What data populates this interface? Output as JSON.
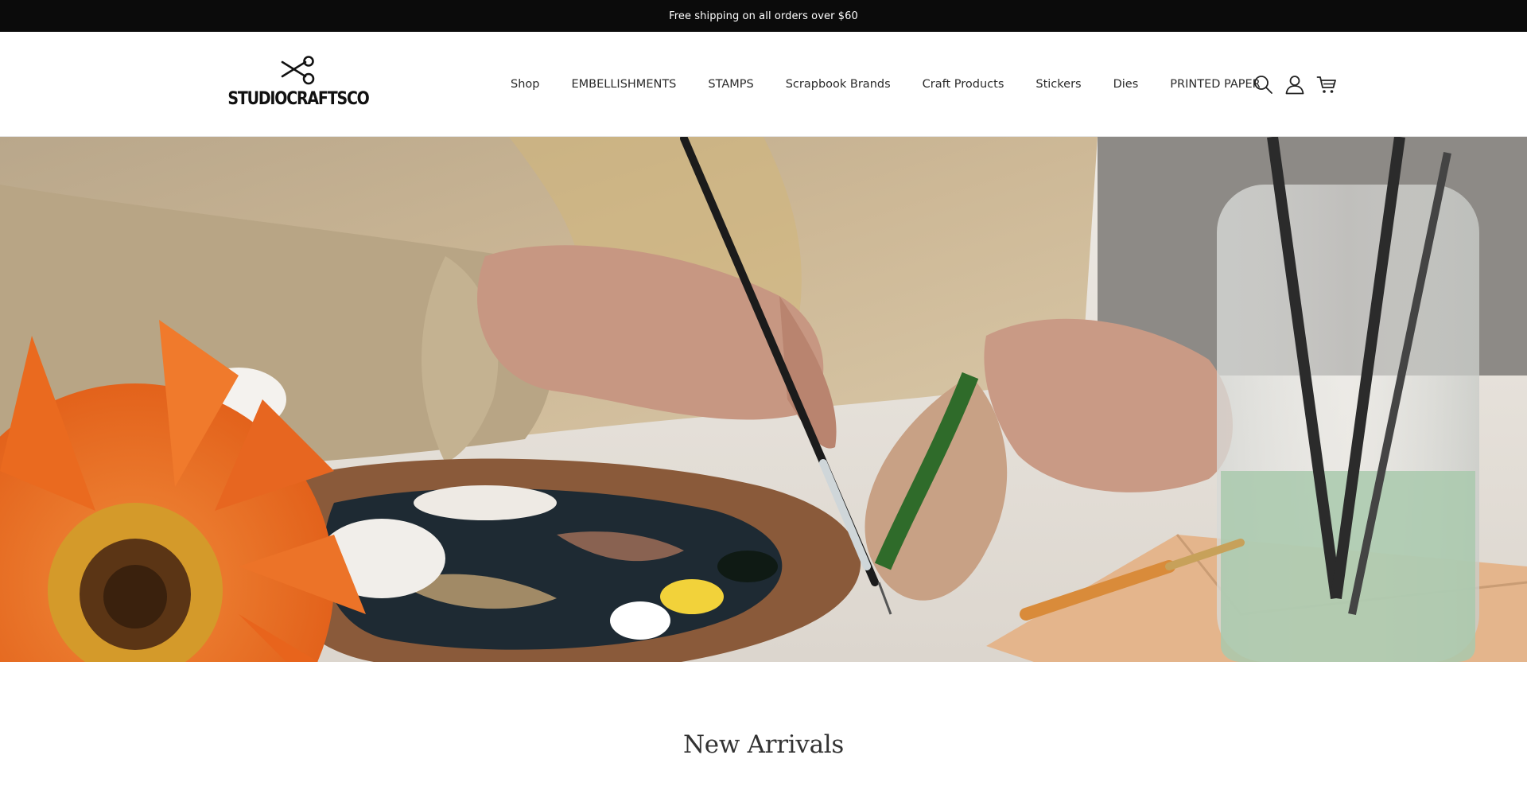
{
  "announcement": {
    "text": "Free shipping on all orders over $60"
  },
  "header": {
    "logo_text": "STUDIOCRAFTSCO",
    "nav": [
      {
        "label": "Shop"
      },
      {
        "label": "EMBELLISHMENTS"
      },
      {
        "label": "STAMPS"
      },
      {
        "label": "Scrapbook Brands"
      },
      {
        "label": "Craft Products"
      },
      {
        "label": "Stickers"
      },
      {
        "label": "Dies"
      },
      {
        "label": "PRINTED PAPER"
      }
    ],
    "icons": [
      "search-icon",
      "account-icon",
      "cart-icon"
    ]
  },
  "hero": {
    "image": "hands-painting-wooden-leaf-photo"
  },
  "sections": {
    "new_arrivals_title": "New Arrivals"
  },
  "colors": {
    "announcement_bg": "#0b0b0b",
    "announcement_text": "#ffffff",
    "header_bg": "#ffffff",
    "nav_text": "#2a2a2a"
  }
}
